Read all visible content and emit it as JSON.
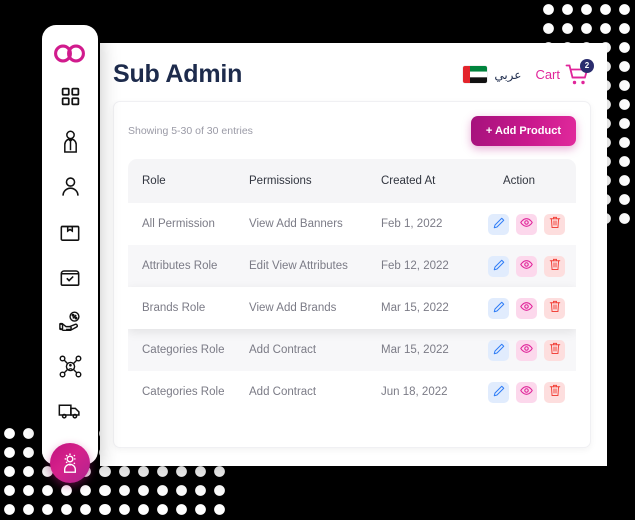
{
  "brand": {
    "logo_icon": "infinity-logo",
    "accent": "#c9188d",
    "title_color": "#1d2b4c"
  },
  "sidebar": {
    "items": [
      {
        "icon": "grid-dashboard-icon",
        "name": "dashboard",
        "active": false
      },
      {
        "icon": "user-tie-icon",
        "name": "staff",
        "active": false
      },
      {
        "icon": "user-icon",
        "name": "customers",
        "active": false
      },
      {
        "icon": "box-icon",
        "name": "products",
        "active": false
      },
      {
        "icon": "box-check-icon",
        "name": "orders",
        "active": false
      },
      {
        "icon": "hand-percent-icon",
        "name": "offers",
        "active": false
      },
      {
        "icon": "network-user-icon",
        "name": "affiliates",
        "active": false
      },
      {
        "icon": "truck-icon",
        "name": "shipping",
        "active": false
      },
      {
        "icon": "user-gear-icon",
        "name": "sub-admin",
        "active": true
      }
    ]
  },
  "header": {
    "title": "Sub Admin",
    "language_label": "عربي",
    "language_flag": "uae-flag-icon",
    "cart_label": "Cart",
    "cart_icon": "shopping-cart-icon",
    "cart_badge": "2",
    "cart_badge_color": "#2b2d6e",
    "cart_label_color": "#e0259a"
  },
  "panel": {
    "entries_info": "Showing 5-30 of 30 entries",
    "add_product_label": "+ Add Product"
  },
  "table": {
    "columns": [
      "Role",
      "Permissions",
      "Created At",
      "Action"
    ],
    "action_icons": [
      "edit-pencil-icon",
      "eye-view-icon",
      "trash-delete-icon"
    ],
    "rows": [
      {
        "role": "All Permission",
        "permissions": "View Add Banners",
        "created_at": "Feb 1, 2022",
        "style": "plain"
      },
      {
        "role": "Attributes Role",
        "permissions": "Edit View Attributes",
        "created_at": "Feb 12, 2022",
        "style": "alt"
      },
      {
        "role": "Brands Role",
        "permissions": "View Add Brands",
        "created_at": "Mar 15, 2022",
        "style": "hovered"
      },
      {
        "role": "Categories Role",
        "permissions": "Add Contract",
        "created_at": "Mar 15, 2022",
        "style": "alt"
      },
      {
        "role": "Categories Role",
        "permissions": "Add Contract",
        "created_at": "Jun 18, 2022",
        "style": "plain"
      }
    ]
  }
}
